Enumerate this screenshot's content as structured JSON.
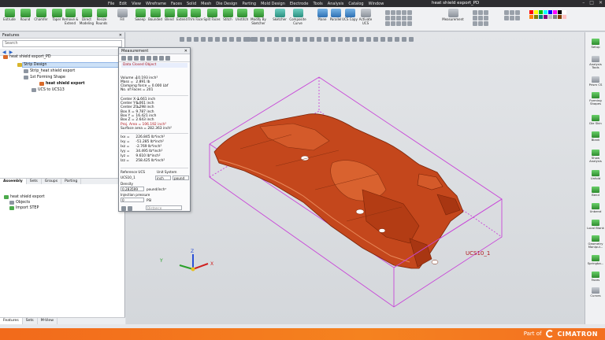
{
  "window": {
    "title": "heat shield export_PD",
    "menu": [
      "File",
      "Edit",
      "View",
      "Wireframe",
      "Faces",
      "Solid",
      "Mesh",
      "Die Design",
      "Parting",
      "Mold Design",
      "Electrode",
      "Tools",
      "Analysis",
      "Catalog",
      "Window"
    ],
    "controls": [
      "–",
      "□",
      "✕"
    ]
  },
  "ribbon": {
    "buttons": [
      {
        "label": "Extrude",
        "icon": "extrude-icon"
      },
      {
        "label": "Round",
        "icon": "round-icon"
      },
      {
        "label": "Chamfer",
        "icon": "chamfer-icon"
      },
      {
        "label": "Taper",
        "icon": "taper-icon"
      },
      {
        "label": "Remove & Extend",
        "icon": "remove-extend-icon"
      },
      {
        "label": "Direct Modeling",
        "icon": "direct-modeling-icon"
      },
      {
        "label": "Resize Rounds",
        "icon": "resize-rounds-icon"
      },
      {
        "label": "Fill",
        "icon": "fill-icon"
      },
      {
        "label": "Sweep",
        "icon": "sweep-icon"
      },
      {
        "label": "Bounded",
        "icon": "bounded-icon"
      },
      {
        "label": "Blend",
        "icon": "blend-icon"
      },
      {
        "label": "Extend",
        "icon": "extend-icon"
      },
      {
        "label": "Trim Face",
        "icon": "trim-face-icon"
      },
      {
        "label": "Split Faces",
        "icon": "split-faces-icon"
      },
      {
        "label": "Stitch",
        "icon": "stitch-icon"
      },
      {
        "label": "Unstitch",
        "icon": "unstitch-icon"
      },
      {
        "label": "Modify By Sketcher",
        "icon": "modify-sketcher-icon"
      },
      {
        "label": "Sketcher",
        "icon": "sketcher-icon"
      },
      {
        "label": "Composite Curve",
        "icon": "composite-curve-icon"
      },
      {
        "label": "Plane",
        "icon": "plane-icon"
      },
      {
        "label": "Parallel",
        "icon": "parallel-icon"
      },
      {
        "label": "UCS Copy",
        "icon": "ucs-copy-icon"
      },
      {
        "label": "Activate UCS",
        "icon": "activate-ucs-icon"
      },
      {
        "label": "Measurement",
        "icon": "measurement-icon"
      }
    ],
    "swatch_colors": [
      "#ff0000",
      "#ffff00",
      "#00c000",
      "#00ffff",
      "#0000ff",
      "#ff00ff",
      "#000000",
      "#ffffff",
      "#ff8000",
      "#808000",
      "#008080",
      "#800080",
      "#c0c0c0",
      "#808080",
      "#804000",
      "#ffc0c0"
    ]
  },
  "features_panel": {
    "title": "Features",
    "search_placeholder": "Search",
    "tree": [
      {
        "label": "heat shield export_PD"
      },
      {
        "label": "Strip Design"
      },
      {
        "label": "Strip_heat shield export"
      },
      {
        "label": "1st Forming Shape"
      },
      {
        "label": "heat shield export"
      },
      {
        "label": "UCS to UCS13"
      }
    ],
    "tabs": [
      "Assembly",
      "Sets",
      "Groups",
      "Parting"
    ],
    "objects_tree": [
      {
        "label": "heat shield export"
      },
      {
        "label": "Objects"
      },
      {
        "label": "Import STEP"
      }
    ],
    "bottom_tabs": [
      "Features",
      "Sets",
      "M-View"
    ]
  },
  "measurement": {
    "title": "Measurement",
    "selection": "Data   Closed Object",
    "lines_a": [
      {
        "k": "Volume =",
        "v": "10.193 inch³"
      },
      {
        "k": "Mass =",
        "v": "2.891 lb"
      },
      {
        "k": "Clamping force =",
        "v": "0.000 Lbf"
      },
      {
        "k": "No. of Faces =",
        "v": "201"
      }
    ],
    "lines_b": [
      {
        "k": "Center X =",
        "v": "-1.661 inch"
      },
      {
        "k": "Center Y =",
        "v": "6.061 inch"
      },
      {
        "k": "Center Z =",
        "v": "0.298 inch"
      },
      {
        "k": "Box X =",
        "v": "9.787 inch"
      },
      {
        "k": "Box Y =",
        "v": "16.421 inch"
      },
      {
        "k": "Box Z =",
        "v": "2.643 inch"
      }
    ],
    "proj_area": "Proj. Area = 106.192 inch²",
    "surface_area": "Surface area = 282.363 inch²",
    "lines_c": [
      {
        "k": "Ixx =",
        "v": "226.845 lb*inch²"
      },
      {
        "k": "Ixy =",
        "v": "-51.285 lb*inch²"
      },
      {
        "k": "Ixz =",
        "v": "-2.769 lb*inch²"
      },
      {
        "k": "Iyy =",
        "v": "34.495 lb*inch²"
      },
      {
        "k": "Iyz =",
        "v": "9.610 lb*inch²"
      },
      {
        "k": "Izz =",
        "v": "258.425 lb*inch²"
      }
    ],
    "reference_label": "Reference UCS",
    "unit_system_label": "Unit System",
    "ucs_value": "UCS10_1",
    "unit_length": "inch",
    "unit_mass": "pound",
    "density_label": "Density",
    "density_value": "0.283599",
    "density_unit": "pound/inch³",
    "pressure_label": "Injection pressure",
    "pressure_value": "0",
    "pressure_unit": "PSI",
    "distance_label": "Distance"
  },
  "viewport": {
    "ucs_label": "UCS10_1",
    "axis_labels": {
      "x": "X",
      "y": "Y",
      "z": "Z"
    },
    "part_color": "#c4471c",
    "box_color": "#c847d8"
  },
  "right_toolbar": [
    {
      "label": "Setup",
      "icon": "setup-icon"
    },
    {
      "label": "Analysis Tools",
      "icon": "analysis-tools-icon"
    },
    {
      "label": "Prism CS",
      "icon": "prism-cs-icon"
    },
    {
      "label": "Forming Shapes",
      "icon": "forming-shapes-icon"
    },
    {
      "label": "Die Skin",
      "icon": "die-skin-icon"
    },
    {
      "label": "Blank",
      "icon": "blank-icon"
    },
    {
      "label": "Show Analysis",
      "icon": "show-analysis-icon"
    },
    {
      "label": "Unfold",
      "icon": "unfold-icon"
    },
    {
      "label": "Bend",
      "icon": "bend-icon"
    },
    {
      "label": "Unbend",
      "icon": "unbend-icon"
    },
    {
      "label": "Local Blank",
      "icon": "local-blank-icon"
    },
    {
      "label": "Geometry Manipul...",
      "icon": "geometry-manipulation-icon"
    },
    {
      "label": "Springba...",
      "icon": "springback-icon"
    },
    {
      "label": "Faces",
      "icon": "faces-icon"
    },
    {
      "label": "Curves",
      "icon": "curves-icon"
    }
  ],
  "branding": {
    "prefix": "Part of",
    "name": "CIMATRON"
  }
}
